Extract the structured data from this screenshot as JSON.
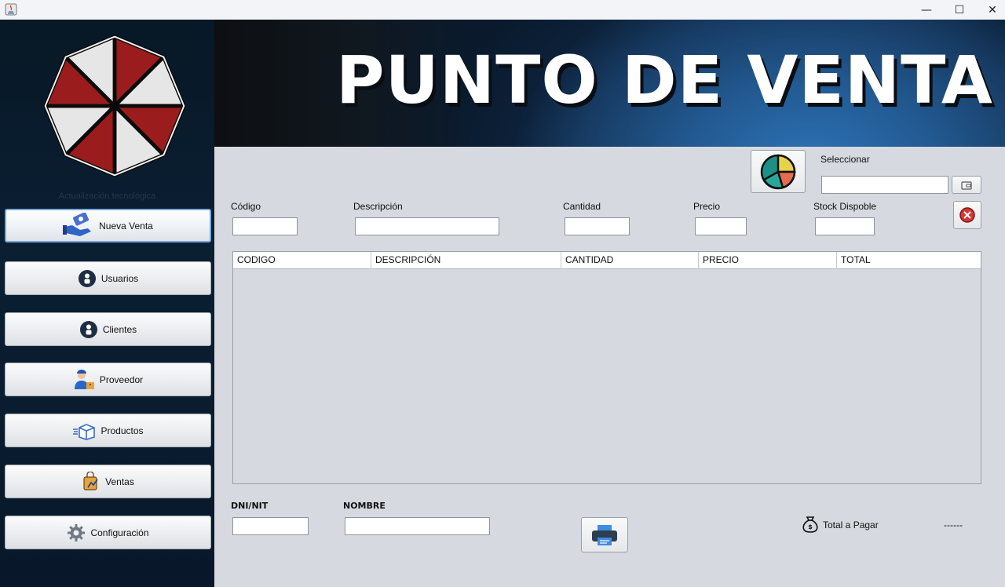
{
  "window": {
    "minimize_glyph": "—",
    "maximize_glyph": "☐",
    "close_glyph": "✕"
  },
  "sidebar": {
    "tagline": "Actualización tecnológica",
    "items": [
      {
        "label": "Nueva Venta",
        "icon": "sale-hand-icon",
        "active": true
      },
      {
        "label": "Usuarios",
        "icon": "user-icon"
      },
      {
        "label": "Clientes",
        "icon": "user-icon"
      },
      {
        "label": "Proveedor",
        "icon": "delivery-worker-icon"
      },
      {
        "label": "Productos",
        "icon": "box-icon"
      },
      {
        "label": "Ventas",
        "icon": "sales-bag-icon"
      },
      {
        "label": "Configuración",
        "icon": "gear-icon"
      }
    ]
  },
  "header": {
    "title": "PUNTO DE VENTA"
  },
  "form": {
    "select_label": "Seleccionar",
    "codigo_label": "Código",
    "descripcion_label": "Descripción",
    "cantidad_label": "Cantidad",
    "precio_label": "Precio",
    "stock_label": "Stock Dispoble",
    "codigo_value": "",
    "descripcion_value": "",
    "cantidad_value": "",
    "precio_value": "",
    "stock_value": "",
    "select_value": ""
  },
  "table": {
    "columns": [
      "CODIGO",
      "DESCRIPCIÓN",
      "CANTIDAD",
      "PRECIO",
      "TOTAL"
    ],
    "rows": []
  },
  "client": {
    "dni_label": "DNI/NIT",
    "nombre_label": "NOMBRE",
    "dni_value": "",
    "nombre_value": ""
  },
  "totals": {
    "label": "Total a Pagar",
    "value": "------"
  },
  "colors": {
    "sidebar_bg": "#0b1f33",
    "panel_bg": "#d6d9df",
    "banner_blue": "#22588f",
    "umbrella_red": "#9b1c1c"
  }
}
